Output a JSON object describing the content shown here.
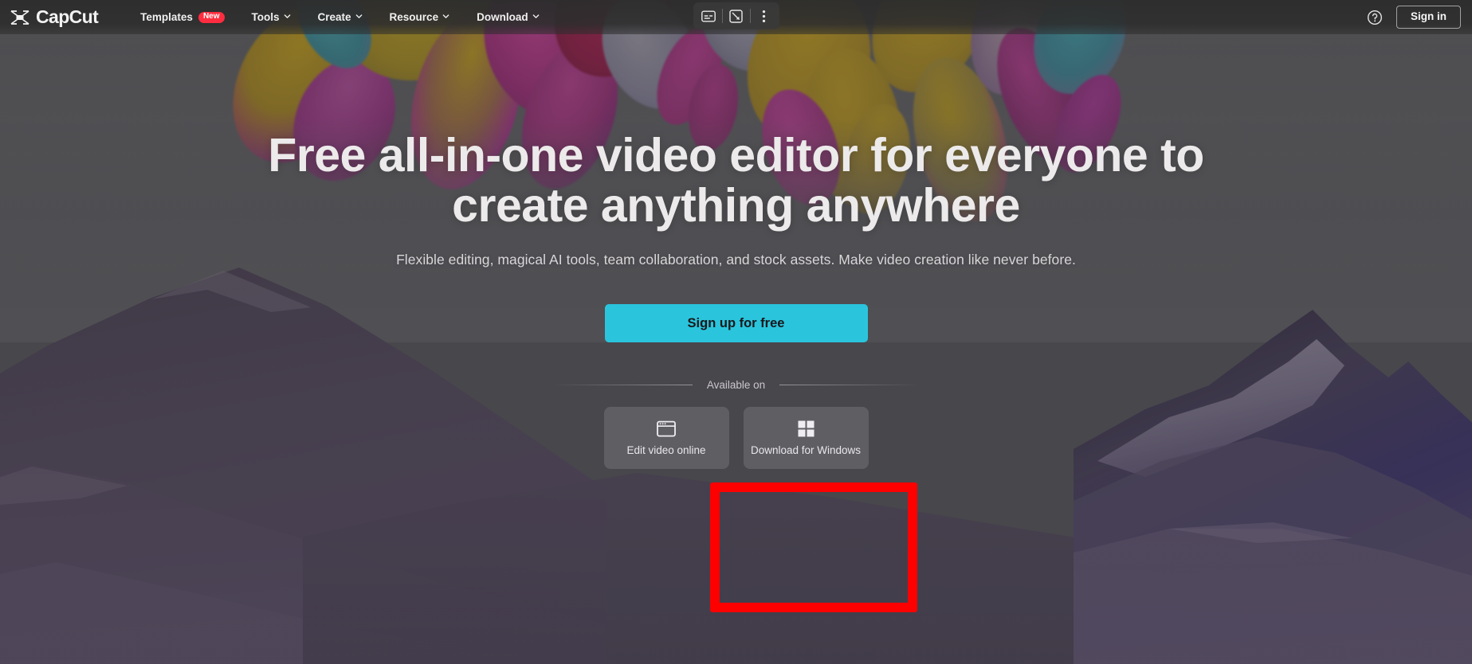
{
  "brand": {
    "name": "CapCut",
    "logo_icon": "capcut-logo-icon"
  },
  "header": {
    "nav_items": [
      {
        "label": "Templates",
        "badge": "New",
        "has_caret": false
      },
      {
        "label": "Tools",
        "badge": null,
        "has_caret": true
      },
      {
        "label": "Create",
        "badge": null,
        "has_caret": true
      },
      {
        "label": "Resource",
        "badge": null,
        "has_caret": true
      },
      {
        "label": "Download",
        "badge": null,
        "has_caret": true
      }
    ],
    "center_tools": [
      {
        "icon": "captions-icon",
        "title": "Captions"
      },
      {
        "icon": "screenshot-icon",
        "title": "Screenshot"
      },
      {
        "icon": "more-vertical-icon",
        "title": "More"
      }
    ],
    "help_icon": "help-circle-icon",
    "sign_in_label": "Sign in"
  },
  "hero": {
    "headline": "Free all-in-one video editor for everyone to create anything anywhere",
    "subheadline": "Flexible editing, magical AI tools, team collaboration, and stock assets. Make video creation like never before.",
    "cta_label": "Sign up for free",
    "available_label": "Available on",
    "download_options": [
      {
        "label": "Edit video online",
        "icon": "browser-window-icon"
      },
      {
        "label": "Download for Windows",
        "icon": "windows-logo-icon"
      }
    ]
  },
  "annotation": {
    "type": "highlight-rectangle",
    "color": "#ff0000",
    "target": "Download for Windows"
  },
  "colors": {
    "accent_cyan": "#2ac5dd",
    "badge_red": "#ff2d3f",
    "annotation_red": "#ff0000",
    "header_bg": "#2d2d2d"
  }
}
